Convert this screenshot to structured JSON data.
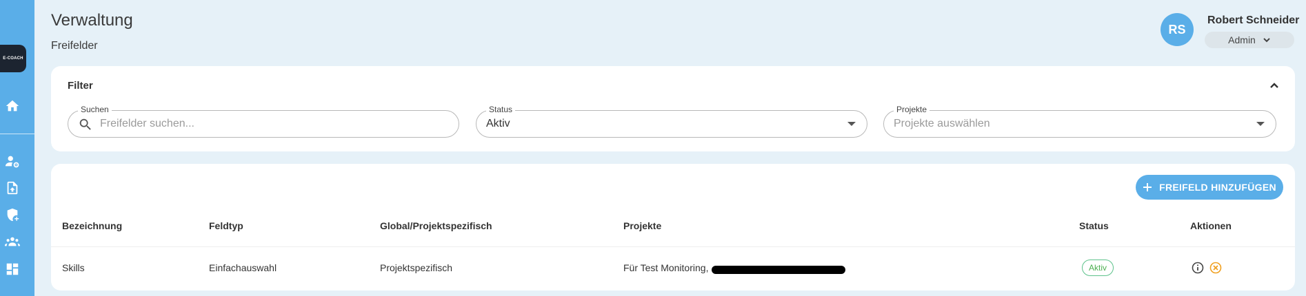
{
  "sidebar": {
    "logo_text": "E-COACH",
    "items": [
      {
        "name": "home-icon"
      },
      {
        "name": "user-settings-icon"
      },
      {
        "name": "file-upload-icon"
      },
      {
        "name": "shield-add-icon"
      },
      {
        "name": "groups-icon"
      },
      {
        "name": "dashboard-icon"
      }
    ],
    "accent_color": "#5aaee8"
  },
  "header": {
    "title": "Verwaltung",
    "subtitle": "Freifelder"
  },
  "user": {
    "initials": "RS",
    "name": "Robert Schneider",
    "role": "Admin"
  },
  "filter": {
    "title": "Filter",
    "search": {
      "label": "Suchen",
      "placeholder": "Freifelder suchen..."
    },
    "status": {
      "label": "Status",
      "value": "Aktiv"
    },
    "projects": {
      "label": "Projekte",
      "placeholder": "Projekte auswählen"
    }
  },
  "table": {
    "add_button_label": "FREIFELD HINZUFÜGEN",
    "columns": [
      "Bezeichnung",
      "Feldtyp",
      "Global/Projektspezifisch",
      "Projekte",
      "Status",
      "Aktionen"
    ],
    "rows": [
      {
        "bezeichnung": "Skills",
        "feldtyp": "Einfachauswahl",
        "scope": "Projektspezifisch",
        "projekte": "Für Test Monitoring,",
        "status": "Aktiv"
      }
    ]
  },
  "colors": {
    "status_active": "#4caf50",
    "delete_action": "#f0a020"
  }
}
